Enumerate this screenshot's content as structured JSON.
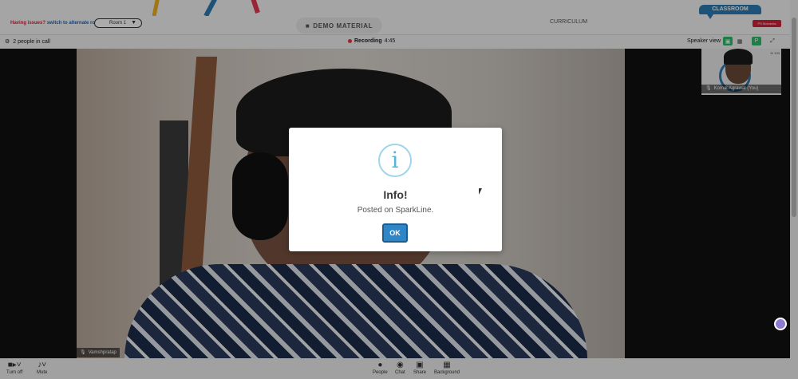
{
  "topbar": {
    "issue_prefix": "Having issues?",
    "issue_link": "switch to alternate room",
    "room_value": "Room 1",
    "demo_label": "DEMO MATERIAL",
    "curriculum_label": "CURRICULUM",
    "classroom_tab": "CLASSROOM",
    "brand_badge": "PS Moments"
  },
  "callbar": {
    "people_count": "2 people in call",
    "recording_label": "Recording",
    "recording_time": "4:45",
    "speaker_view_label": "Speaker view"
  },
  "stage": {
    "main_participant": "Vamshpratap",
    "self_participant": "Komal Agrawal (You)",
    "thumb_time": "11 103"
  },
  "modal": {
    "icon": "i",
    "title": "Info!",
    "message": "Posted on SparkLine.",
    "ok_label": "OK"
  },
  "toolbar": {
    "turn_off": "Turn off",
    "mute": "Mute",
    "people": "People",
    "chat": "Chat",
    "share": "Share",
    "background": "Background"
  },
  "colors": {
    "accent": "#2e7db5",
    "record": "#e53935",
    "badge": "#d2203a",
    "ok_button": "#2f86c7"
  }
}
